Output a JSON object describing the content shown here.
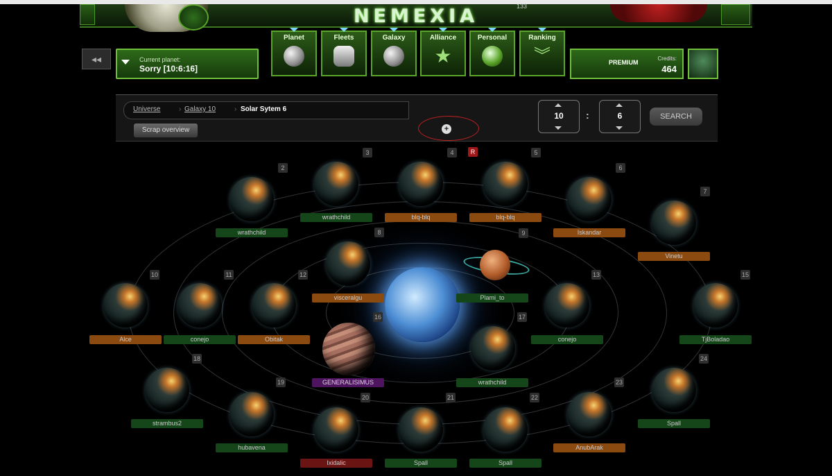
{
  "header": {
    "logo": "NEMEXIA",
    "logo_counter": "133"
  },
  "back_button": {
    "label": "◂◂"
  },
  "current_planet": {
    "label": "Current planet:",
    "value": "Sorry [10:6:16]"
  },
  "nav": [
    {
      "label": "Planet"
    },
    {
      "label": "Fleets"
    },
    {
      "label": "Galaxy"
    },
    {
      "label": "Alliance"
    },
    {
      "label": "Personal"
    },
    {
      "label": "Ranking"
    }
  ],
  "premium": {
    "label": "PREMIUM",
    "credits_label": "Credits:",
    "credits": "464"
  },
  "breadcrumb": {
    "universe": "Universe",
    "galaxy": "Galaxy 10",
    "system": "Solar Sytem 6"
  },
  "scrap_button": "Scrap overview",
  "coords": {
    "galaxy": "10",
    "separator": ":",
    "system": "6"
  },
  "search_button": "SEARCH",
  "expand_icon": "+",
  "red_marker": "R",
  "positions": [
    {
      "num": "2",
      "owner": "wrathchild",
      "color": "green"
    },
    {
      "num": "3",
      "owner": "wrathchild",
      "color": "green"
    },
    {
      "num": "4",
      "owner": "blq-blq",
      "color": "orange"
    },
    {
      "num": "5",
      "owner": "blq-blq",
      "color": "orange"
    },
    {
      "num": "6",
      "owner": "Iskandar",
      "color": "orange"
    },
    {
      "num": "7",
      "owner": "Vinetu",
      "color": "orange"
    },
    {
      "num": "8",
      "owner": "visceralgu",
      "color": "orange"
    },
    {
      "num": "9",
      "owner": "Plami_to",
      "color": "green"
    },
    {
      "num": "10",
      "owner": "Alce",
      "color": "orange"
    },
    {
      "num": "11",
      "owner": "conejo",
      "color": "green"
    },
    {
      "num": "12",
      "owner": "Obitak",
      "color": "orange"
    },
    {
      "num": "13",
      "owner": "conejo",
      "color": "green"
    },
    {
      "num": "15",
      "owner": "TjBoladao",
      "color": "green"
    },
    {
      "num": "16",
      "owner": "GENERALISIMUS",
      "color": "purple"
    },
    {
      "num": "17",
      "owner": "wrathchild",
      "color": "green"
    },
    {
      "num": "18",
      "owner": "strambus2",
      "color": "green"
    },
    {
      "num": "19",
      "owner": "hubavena",
      "color": "green"
    },
    {
      "num": "20",
      "owner": "Ixidalic",
      "color": "red"
    },
    {
      "num": "21",
      "owner": "Spall",
      "color": "green"
    },
    {
      "num": "22",
      "owner": "Spall",
      "color": "green"
    },
    {
      "num": "23",
      "owner": "AnubArak",
      "color": "orange"
    },
    {
      "num": "24",
      "owner": "Spall",
      "color": "green"
    }
  ],
  "colors": {
    "accent_green": "#5aa52a",
    "owner_green": "#14461a",
    "owner_orange": "#8a4a10",
    "owner_red": "#6a1414",
    "owner_purple": "#4f1460"
  }
}
